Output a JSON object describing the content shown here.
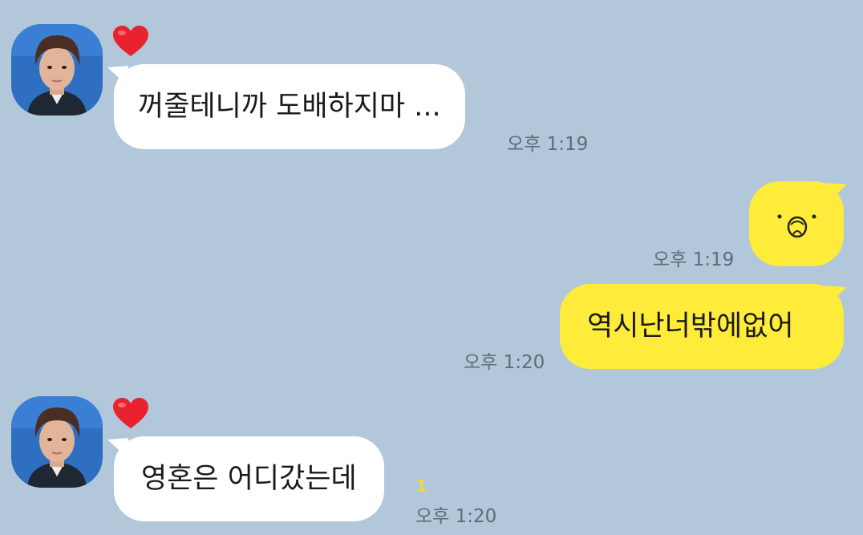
{
  "colors": {
    "background": "#b2c7da",
    "incoming_bubble": "#ffffff",
    "outgoing_bubble": "#ffeb3a",
    "timestamp": "#5f6b76",
    "unread_count": "#e9d94a",
    "heart": "#e8222e"
  },
  "messages": [
    {
      "text": "꺼줄테니까 도배하지마 ...",
      "time": "오후 1:19"
    },
    {
      "emoticon": "ʘᗝʘ",
      "time": "오후 1:19"
    },
    {
      "text": "역시난너밖에없어",
      "time": "오후 1:20"
    },
    {
      "text": "영혼은 어디갔는데",
      "time": "오후 1:20",
      "unread": "1"
    }
  ]
}
